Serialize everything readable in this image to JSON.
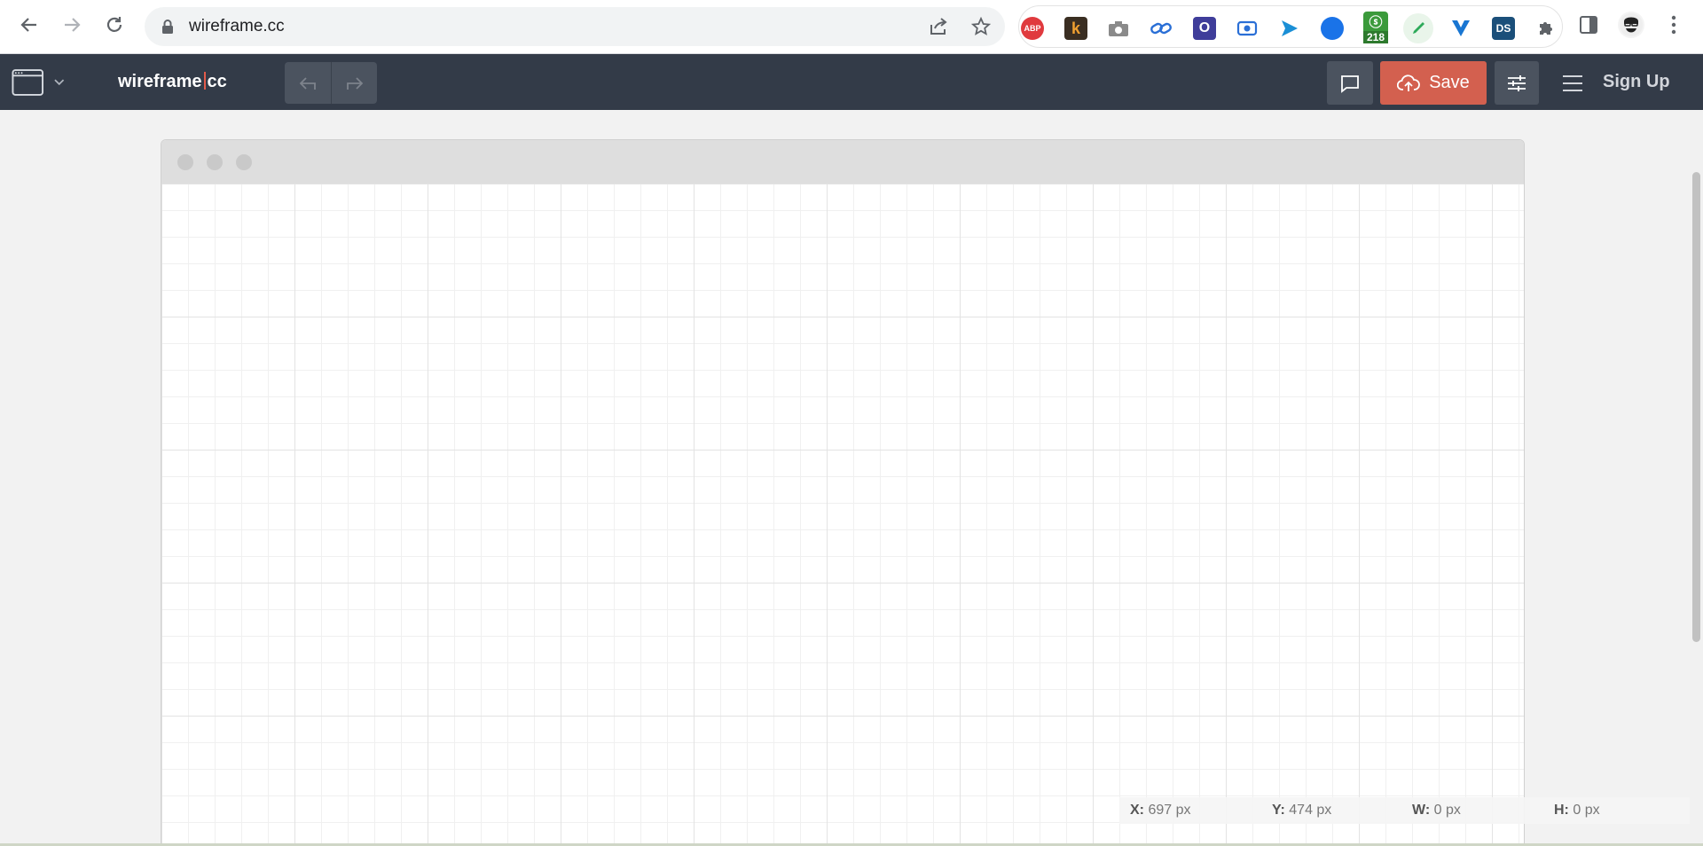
{
  "browser": {
    "url": "wireframe.cc",
    "extensions": [
      {
        "name": "adblock-plus",
        "label": "ABP",
        "color": "#e03a3e"
      },
      {
        "name": "k-extension",
        "label": "k",
        "color": "#3a2e22"
      },
      {
        "name": "camera",
        "label": "",
        "color": "#8a8a8a"
      },
      {
        "name": "link",
        "label": "",
        "color": "#2a6fd6"
      },
      {
        "name": "o-extension",
        "label": "O",
        "color": "#3f3d9a"
      },
      {
        "name": "record",
        "label": "",
        "color": "#2a6fd6"
      },
      {
        "name": "send",
        "label": "",
        "color": "#1a8fd6"
      },
      {
        "name": "blue-dot",
        "label": "",
        "color": "#1a73e8"
      },
      {
        "name": "badge-218",
        "label": "218",
        "color": "#3b9a3b"
      },
      {
        "name": "highlighter",
        "label": "",
        "color": "#2eaa5a"
      },
      {
        "name": "y-extension",
        "label": "",
        "color": "#1976d2"
      },
      {
        "name": "ds-extension",
        "label": "",
        "color": "#1b4f7a"
      }
    ]
  },
  "app": {
    "logo_left": "wireframe",
    "logo_right": "cc",
    "save_label": "Save",
    "signup_label": "Sign Up"
  },
  "status": {
    "x_label": "X:",
    "x_value": "697 px",
    "y_label": "Y:",
    "y_value": "474 px",
    "w_label": "W:",
    "w_value": "0 px",
    "h_label": "H:",
    "h_value": "0 px"
  }
}
